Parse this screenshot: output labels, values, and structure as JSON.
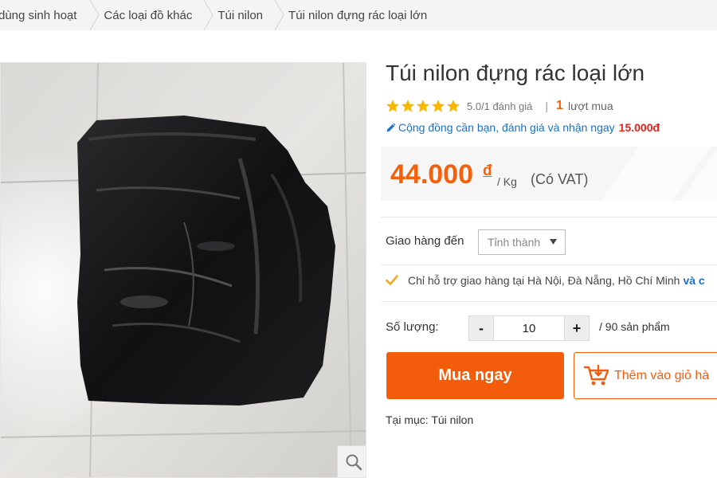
{
  "breadcrumb": [
    "dùng sinh hoạt",
    "Các loại đồ khác",
    "Túi nilon",
    "Túi nilon đựng rác loại lớn"
  ],
  "product": {
    "title": "Túi nilon đựng rác loại lớn",
    "rating_text": "5.0/1 đánh giá",
    "rating_separator": "|",
    "sold_count": "1",
    "sold_label": "lượt mua",
    "promo_text": "Cộng đồng cần bạn, đánh giá và nhận ngay",
    "promo_amount": "15.000đ",
    "price": "44.000",
    "currency": "đ",
    "unit": "/ Kg",
    "vat": "(Có VAT)"
  },
  "shipping": {
    "label": "Giao hàng đến",
    "select_value": "Tỉnh thành",
    "note": "Chỉ hỗ trợ giao hàng tại Hà Nội, Đà Nẵng, Hồ Chí Minh",
    "note_link": "và c"
  },
  "quantity": {
    "label": "Số lượng:",
    "minus": "-",
    "value": "10",
    "plus": "+",
    "stock": "/ 90 sản phẩm"
  },
  "actions": {
    "buy_now": "Mua ngay",
    "add_to_cart": "Thêm vào giỏ hà"
  },
  "category": "Tại mục: Túi nilon",
  "icons": {
    "star": "star-icon",
    "pencil": "pencil-icon",
    "check": "check-icon",
    "cart": "cart-icon",
    "zoom": "zoom-icon",
    "caret": "caret-down-icon"
  },
  "colors": {
    "accent": "#f35c0b",
    "price": "#f5600a",
    "link": "#1b6fc8",
    "star": "#f9b800",
    "promo_amount": "#e8211a"
  }
}
